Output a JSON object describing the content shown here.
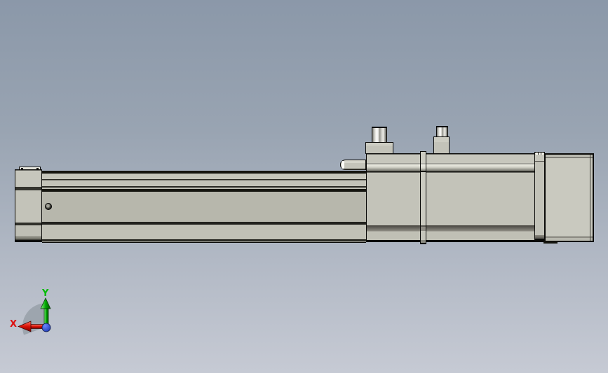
{
  "viewport": {
    "background_top_color": "#8b98a9",
    "background_bottom_color": "#c6cad4",
    "content": "3D CAD side view of a motorized linear actuator rail assembly"
  },
  "model": {
    "face_color": "#c3c3b9",
    "outline_color": "#0a0a08",
    "parts": [
      "end-cap",
      "rail-body",
      "screw-hole",
      "carriage-plate",
      "motor-housing",
      "clamp-band",
      "connector-large",
      "connector-small",
      "motor-flange",
      "motor-body"
    ]
  },
  "triad": {
    "x_label": "X",
    "y_label": "Y",
    "x_color": "#dd1111",
    "y_color": "#00bb00",
    "origin_color": "#2a49d0"
  }
}
